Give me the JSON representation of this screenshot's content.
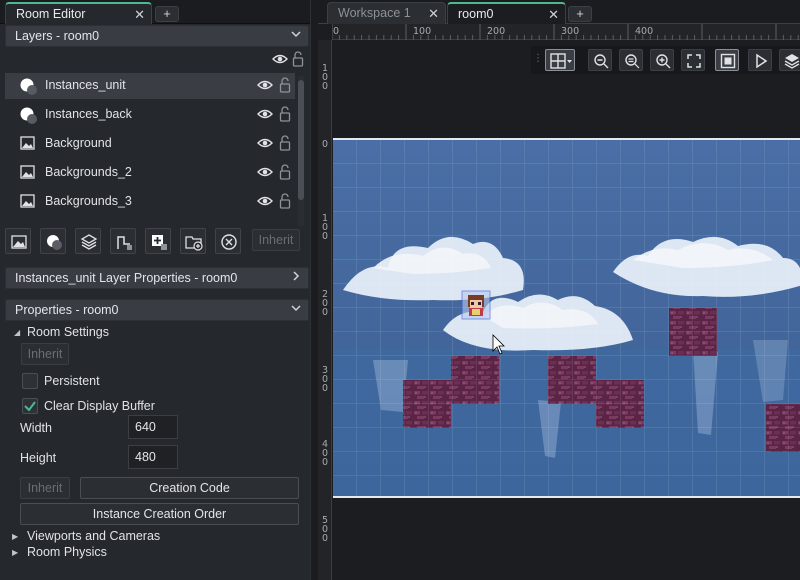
{
  "left_tabs": {
    "active": "Room Editor",
    "plus": "+"
  },
  "layers_section": {
    "title": "Layers - room0"
  },
  "layers": [
    {
      "name": "Instances_unit",
      "type": "instance",
      "selected": true
    },
    {
      "name": "Instances_back",
      "type": "instance",
      "selected": false
    },
    {
      "name": "Background",
      "type": "background",
      "selected": false
    },
    {
      "name": "Backgrounds_2",
      "type": "background",
      "selected": false
    },
    {
      "name": "Backgrounds_3",
      "type": "background",
      "selected": false
    }
  ],
  "layer_toolbar": {
    "inherit": "Inherit"
  },
  "layer_props_section": {
    "title": "Instances_unit Layer Properties - room0"
  },
  "properties_section": {
    "title": "Properties - room0"
  },
  "room_settings": {
    "title": "Room Settings",
    "inherit": "Inherit",
    "persistent_label": "Persistent",
    "persistent_checked": false,
    "clear_label": "Clear Display Buffer",
    "clear_checked": true,
    "width_label": "Width",
    "width_value": "640",
    "height_label": "Height",
    "height_value": "480",
    "inherit2": "Inherit",
    "creation_code": "Creation Code",
    "instance_order": "Instance Creation Order"
  },
  "groups": {
    "viewports": "Viewports and Cameras",
    "physics": "Room Physics"
  },
  "right_tabs": [
    {
      "label": "Workspace 1",
      "active": false
    },
    {
      "label": "room0",
      "active": true
    }
  ],
  "ruler_h": [
    "0",
    "100",
    "200",
    "300",
    "400"
  ],
  "ruler_v": [
    "100",
    "0",
    "100",
    "200",
    "300",
    "400",
    "500"
  ],
  "colors": {
    "accent": "#4fb890",
    "room_bg": "#3f6396",
    "panel": "#25282c"
  }
}
